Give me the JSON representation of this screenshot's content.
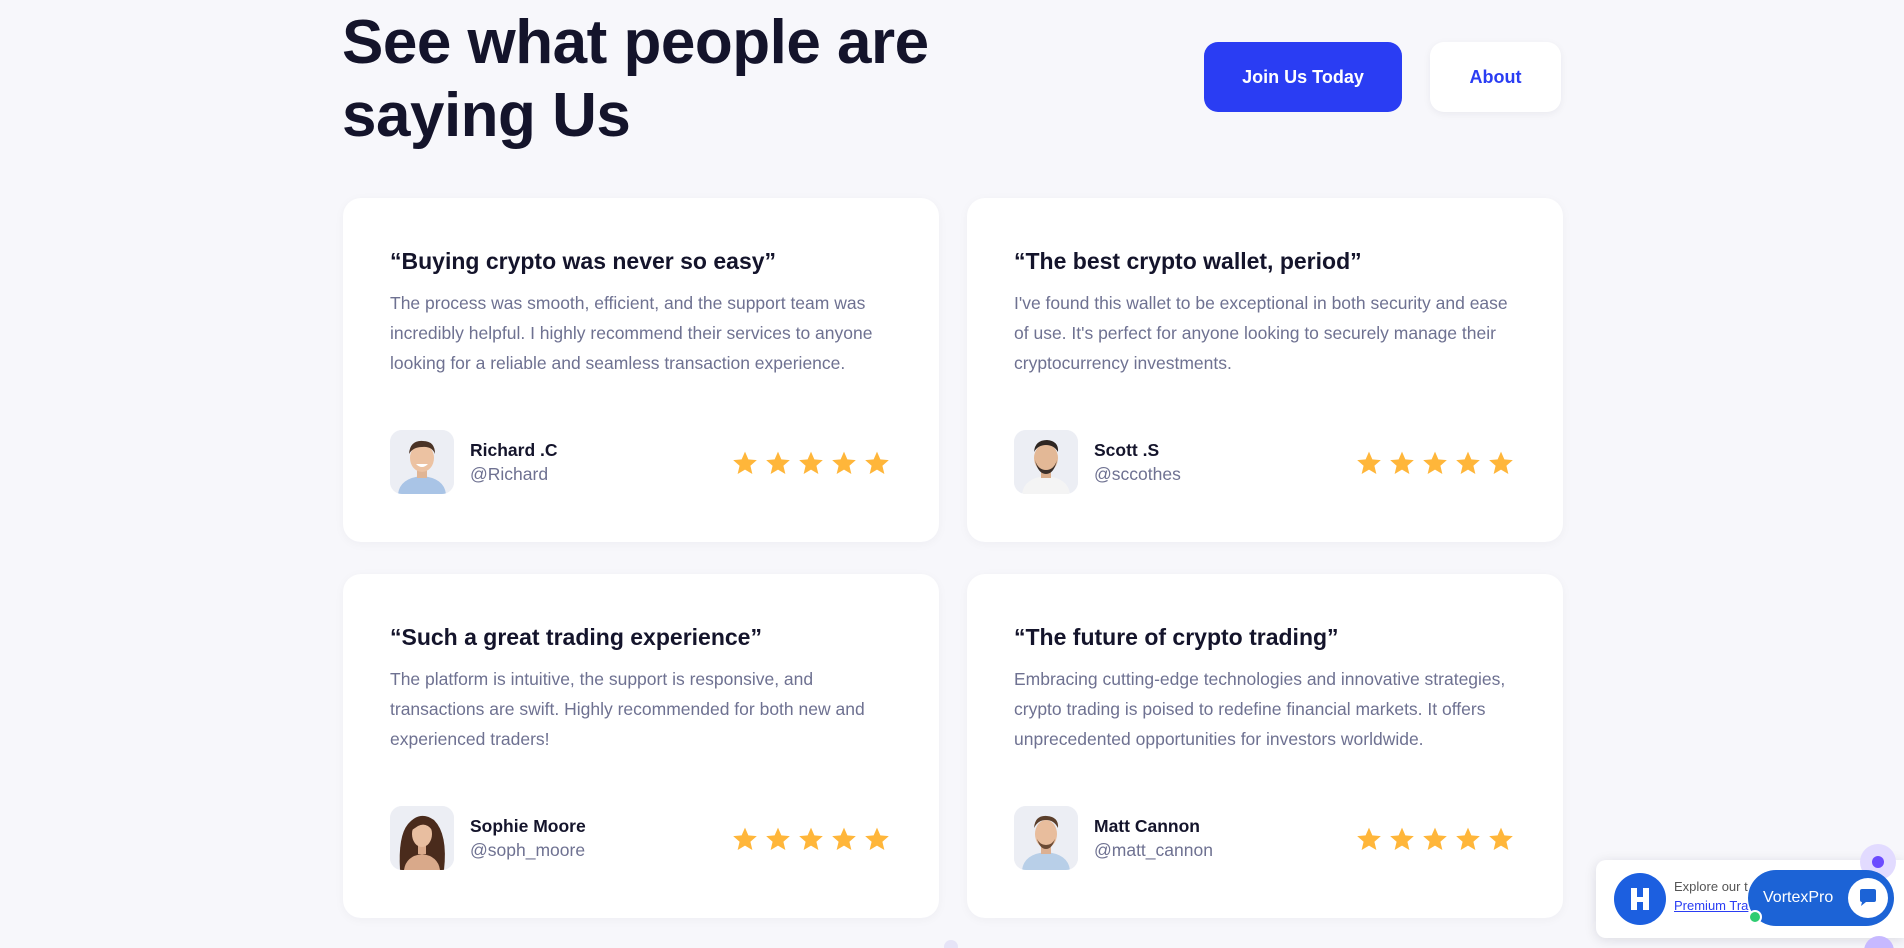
{
  "header": {
    "headline": "See what people are saying Us",
    "primary_button": "Join Us Today",
    "secondary_button": "About"
  },
  "colors": {
    "primary": "#2a3df3",
    "star": "#ffb63a",
    "title": "#14142b",
    "body": "#6e7191"
  },
  "testimonials": [
    {
      "title": "“Buying crypto was never so easy”",
      "body": "The process was smooth, efficient, and the support team was incredibly helpful. I highly recommend their services to anyone looking for a reliable and seamless transaction experience.",
      "name": "Richard .C",
      "handle": "@Richard",
      "rating": 5
    },
    {
      "title": "“The best crypto wallet, period”",
      "body": "I've found this wallet to be exceptional in both security and ease of use. It's perfect for anyone looking to securely manage their cryptocurrency investments.",
      "name": "Scott .S",
      "handle": "@sccothes",
      "rating": 5
    },
    {
      "title": "“Such a great trading experience”",
      "body": "The platform is intuitive, the support is responsive, and transactions are swift. Highly recommended for both new and experienced traders!",
      "name": "Sophie Moore",
      "handle": "@soph_moore",
      "rating": 5
    },
    {
      "title": "“The future of crypto trading”",
      "body": "Embracing cutting-edge technologies and innovative strategies, crypto trading is poised to redefine financial markets. It offers unprecedented opportunities for investors worldwide.",
      "name": "Matt Cannon",
      "handle": "@matt_cannon",
      "rating": 5
    }
  ],
  "chat": {
    "line1": "Explore our t",
    "line2": "Premium Tra",
    "brand": "VortexPro"
  }
}
